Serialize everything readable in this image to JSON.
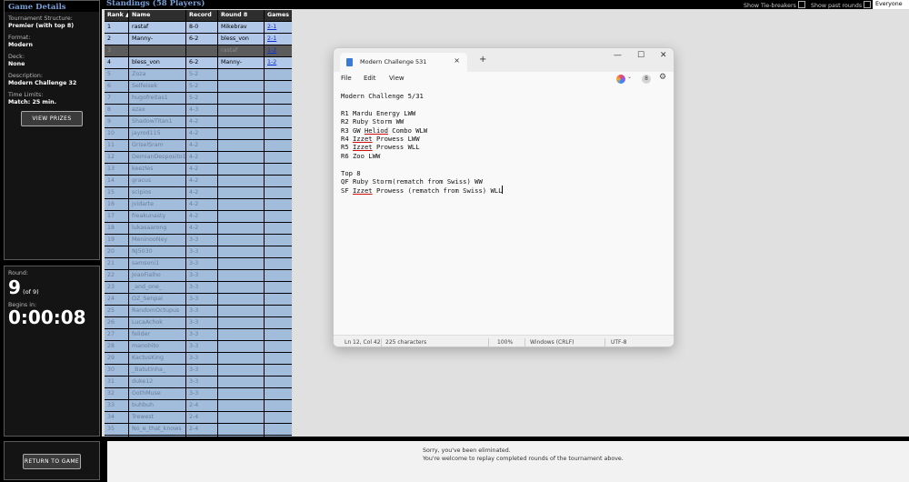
{
  "game_details": {
    "title": "Game Details",
    "structure_label": "Tournament Structure:",
    "structure_value": "Premier (with top 8)",
    "format_label": "Format:",
    "format_value": "Modern",
    "deck_label": "Deck:",
    "deck_value": "None",
    "description_label": "Description:",
    "description_value": "Modern Challenge 32",
    "time_label": "Time Limits:",
    "time_value": "Match: 25 min.",
    "view_prizes": "VIEW PRIZES"
  },
  "round": {
    "label": "Round:",
    "number": "9",
    "of": "(of 9)",
    "begins_label": "Begins in:",
    "timer": "0:00:08"
  },
  "return_button": "RETURN TO GAME",
  "topbar": {
    "title": "Standings (58 Players)",
    "show_tiebreakers": "Show Tie-breakers",
    "show_past_rounds": "Show past rounds",
    "filter": "Everyone"
  },
  "standings": {
    "headers": [
      "Rank ▲",
      "Name",
      "Record",
      "Round 8",
      "Games"
    ],
    "rows": [
      {
        "rank": "1",
        "name": "rastaf",
        "record": "8-0",
        "r8": "Mikebrav",
        "games": "2-1"
      },
      {
        "rank": "2",
        "name": "Manny-",
        "record": "6-2",
        "r8": "bless_von",
        "games": "2-1"
      },
      {
        "rank": "3",
        "name": "",
        "record": "",
        "r8": "rastaf",
        "games": "1-2"
      },
      {
        "rank": "4",
        "name": "bless_von",
        "record": "6-2",
        "r8": "Manny-",
        "games": "1-2"
      },
      {
        "rank": "5",
        "name": "Zoza",
        "record": "5-2",
        "r8": "",
        "games": ""
      },
      {
        "rank": "6",
        "name": "Selfeisek",
        "record": "5-2",
        "r8": "",
        "games": ""
      },
      {
        "rank": "7",
        "name": "hugofreitas1",
        "record": "5-2",
        "r8": "",
        "games": ""
      },
      {
        "rank": "8",
        "name": "azax",
        "record": "4-3",
        "r8": "",
        "games": ""
      },
      {
        "rank": "9",
        "name": "ShadowTitan1",
        "record": "4-2",
        "r8": "",
        "games": ""
      },
      {
        "rank": "10",
        "name": "jayrod115",
        "record": "4-2",
        "r8": "",
        "games": ""
      },
      {
        "rank": "11",
        "name": "GriselSram",
        "record": "4-2",
        "r8": "",
        "games": ""
      },
      {
        "rank": "12",
        "name": "DemianDesposito10",
        "record": "4-2",
        "r8": "",
        "games": ""
      },
      {
        "rank": "13",
        "name": "keezles",
        "record": "4-2",
        "r8": "",
        "games": ""
      },
      {
        "rank": "14",
        "name": "gracus",
        "record": "4-2",
        "r8": "",
        "games": ""
      },
      {
        "rank": "15",
        "name": "scipios",
        "record": "4-2",
        "r8": "",
        "games": ""
      },
      {
        "rank": "16",
        "name": "jvidarte",
        "record": "4-2",
        "r8": "",
        "games": ""
      },
      {
        "rank": "17",
        "name": "freakunasty",
        "record": "4-2",
        "r8": "",
        "games": ""
      },
      {
        "rank": "18",
        "name": "lukasaarong",
        "record": "4-2",
        "r8": "",
        "games": ""
      },
      {
        "rank": "19",
        "name": "MeninooNey",
        "record": "3-3",
        "r8": "",
        "games": ""
      },
      {
        "rank": "20",
        "name": "NJ5030",
        "record": "3-3",
        "r8": "",
        "games": ""
      },
      {
        "rank": "21",
        "name": "samsoni1",
        "record": "3-3",
        "r8": "",
        "games": ""
      },
      {
        "rank": "22",
        "name": "JoaoFialho",
        "record": "3-3",
        "r8": "",
        "games": ""
      },
      {
        "rank": "23",
        "name": "_and_one_",
        "record": "3-3",
        "r8": "",
        "games": ""
      },
      {
        "rank": "24",
        "name": "OZ_Senpai",
        "record": "3-3",
        "r8": "",
        "games": ""
      },
      {
        "rank": "25",
        "name": "RandomOctupus",
        "record": "3-3",
        "r8": "",
        "games": ""
      },
      {
        "rank": "26",
        "name": "LucaAchok",
        "record": "3-3",
        "r8": "",
        "games": ""
      },
      {
        "rank": "27",
        "name": "felider",
        "record": "3-3",
        "r8": "",
        "games": ""
      },
      {
        "rank": "28",
        "name": "manohito",
        "record": "3-3",
        "r8": "",
        "games": ""
      },
      {
        "rank": "29",
        "name": "KactusKing",
        "record": "3-3",
        "r8": "",
        "games": ""
      },
      {
        "rank": "30",
        "name": "_Batutinha_",
        "record": "3-3",
        "r8": "",
        "games": ""
      },
      {
        "rank": "31",
        "name": "duke12",
        "record": "3-3",
        "r8": "",
        "games": ""
      },
      {
        "rank": "32",
        "name": "GothMuse",
        "record": "3-3",
        "r8": "",
        "games": ""
      },
      {
        "rank": "33",
        "name": "buhbuh",
        "record": "2-4",
        "r8": "",
        "games": ""
      },
      {
        "rank": "34",
        "name": "Trewest",
        "record": "2-4",
        "r8": "",
        "games": ""
      },
      {
        "rank": "35",
        "name": "No_e_that_knows",
        "record": "2-4",
        "r8": "",
        "games": ""
      },
      {
        "rank": "36",
        "name": "MisterTwin",
        "record": "2-4",
        "r8": "",
        "games": ""
      }
    ]
  },
  "message": {
    "line1": "Sorry, you've been eliminated.",
    "line2": "You're welcome to replay completed rounds of the tournament above."
  },
  "notepad": {
    "tab_title": "Modern Challenge 531",
    "menu": [
      "File",
      "Edit",
      "View"
    ],
    "account_initial": "8",
    "lines": {
      "title": "Modern Challenge 5/31",
      "r1": "R1 Mardu Energy LWW",
      "r2": "R2 Ruby Storm WW",
      "r3a": "R3 GW ",
      "r3b": "Heliod",
      "r3c": " Combo WLW",
      "r4a": "R4 ",
      "r4b": "Izzet",
      "r4c": " Prowess LWW",
      "r5a": "R5 ",
      "r5b": "Izzet",
      "r5c": " Prowess WLL",
      "r6": "R6 Zoo LWW",
      "top8": "Top 8",
      "qf": "QF Ruby Storm(rematch from Swiss) WW",
      "sfa": "SF ",
      "sfb": "Izzet",
      "sfc": " Prowess (rematch from Swiss) WLL"
    },
    "status": {
      "position": "Ln 12, Col 42",
      "chars": "225 characters",
      "zoom": "100%",
      "line_ending": "Windows (CRLF)",
      "encoding": "UTF-8"
    }
  }
}
